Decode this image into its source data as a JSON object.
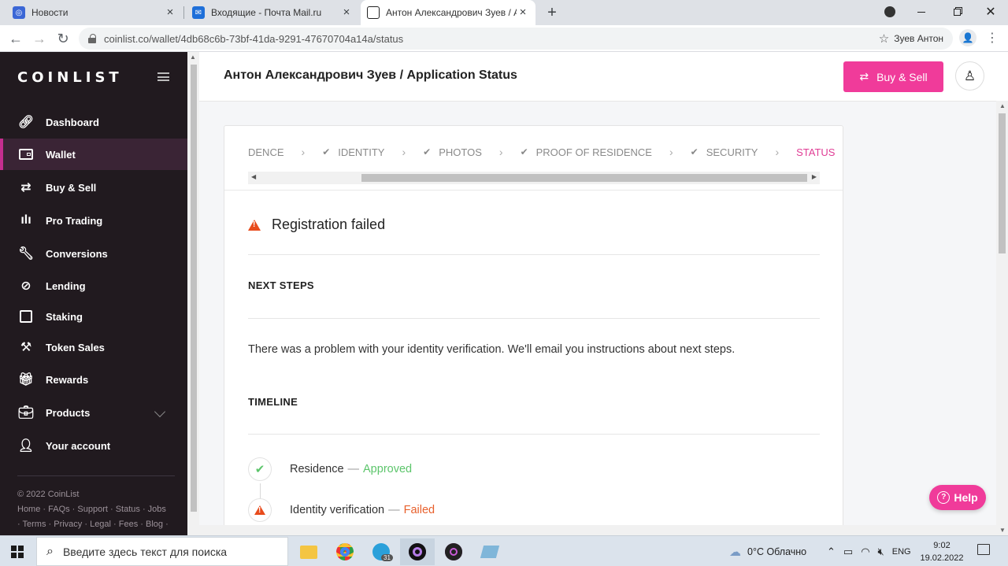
{
  "browser": {
    "tabs": [
      {
        "label": "Новости",
        "icon": "news-icon",
        "color": "#3b67d6"
      },
      {
        "label": "Входящие - Почта Mail.ru",
        "icon": "mail-icon",
        "color": "#1e6fd9"
      },
      {
        "label": "Антон Александрович Зуев / Ap",
        "icon": "coinlist-icon",
        "color": "#222222"
      }
    ],
    "close_glyph": "×",
    "new_tab": "+",
    "url": "coinlist.co/wallet/4db68c6b-73bf-41da-9291-47670704a14a/status",
    "profile_name": "Зуев Антон"
  },
  "sidebar": {
    "logo": "COINLIST",
    "items": [
      {
        "label": "Dashboard",
        "icon": "link-icon"
      },
      {
        "label": "Wallet",
        "icon": "wallet-icon",
        "active": true
      },
      {
        "label": "Buy & Sell",
        "icon": "buy-sell-icon"
      },
      {
        "label": "Pro Trading",
        "icon": "candles-icon"
      },
      {
        "label": "Conversions",
        "icon": "wrench-icon"
      },
      {
        "label": "Lending",
        "icon": "lending-icon"
      },
      {
        "label": "Staking",
        "icon": "staking-icon"
      },
      {
        "label": "Token Sales",
        "icon": "gavel-icon"
      },
      {
        "label": "Rewards",
        "icon": "gift-icon"
      },
      {
        "label": "Products",
        "icon": "briefcase-icon"
      },
      {
        "label": "Your account",
        "icon": "user-icon"
      }
    ],
    "footer": {
      "copyright": "© 2022 CoinList",
      "line1": "Home · FAQs · Support · Status · Jobs",
      "line2": "· Terms · Privacy · Legal · Fees · Blog ·",
      "line3": "· · ·"
    }
  },
  "header": {
    "title": "Антон Александрович Зуев / Application Status",
    "buy_sell_label": "Buy & Sell"
  },
  "steps": [
    {
      "label": "DENCE",
      "checked": false
    },
    {
      "label": "IDENTITY",
      "checked": true
    },
    {
      "label": "PHOTOS",
      "checked": true
    },
    {
      "label": "PROOF OF RESIDENCE",
      "checked": true
    },
    {
      "label": "SECURITY",
      "checked": true
    },
    {
      "label": "STATUS",
      "checked": false,
      "current": true
    }
  ],
  "status": {
    "heading": "Registration failed",
    "next_steps_title": "NEXT STEPS",
    "message": "There was a problem with your identity verification. We'll email you instructions about next steps.",
    "timeline_title": "TIMELINE",
    "timeline": [
      {
        "label": "Residence",
        "dash": "—",
        "state": "Approved",
        "state_color": "#5cc56b"
      },
      {
        "label": "Identity verification",
        "dash": "—",
        "state": "Failed",
        "state_color": "#e8602c"
      }
    ]
  },
  "help_label": "Help",
  "taskbar": {
    "search_placeholder": "Введите здесь текст для поиска",
    "telegram_badge": "31",
    "weather": "0°C  Облачно",
    "lang": "ENG",
    "time": "9:02",
    "date": "19.02.2022"
  },
  "colors": {
    "accent": "#f03b9a",
    "sidebar_bg": "#211a1f",
    "active_step": "#e03d95"
  }
}
